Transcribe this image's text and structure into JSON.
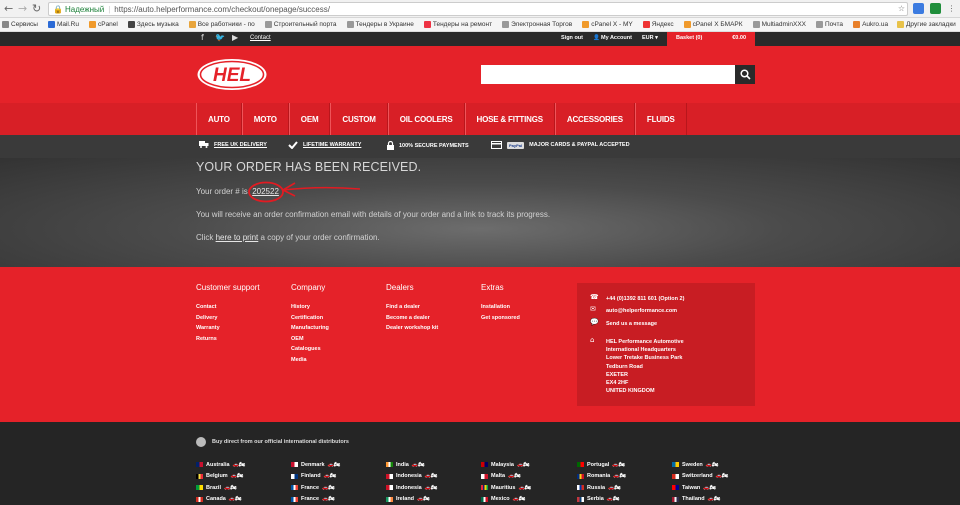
{
  "browser": {
    "secure_label": "Надежный",
    "url": "https://auto.helperformance.com/checkout/onepage/success/",
    "bookmarks": [
      "Сервисы",
      "Mail.Ru",
      "cPanel",
      "Здесь музыка",
      "Все работники - по",
      "Строительный порта",
      "Тендеры в Украине",
      "Тендеры на ремонт",
      "Электронная Торгов",
      "cPanel X - MY",
      "Яндекс",
      "cPanel X БМАРК",
      "MultiadminXXX",
      "Почта",
      "Aukro.ua",
      "Mail.Ru"
    ],
    "other_bookmarks": "Другие закладки"
  },
  "topbar": {
    "contact": "Contact",
    "sign_out": "Sign out",
    "my_account": "My Account",
    "currency": "EUR",
    "basket": "Basket (0)",
    "basket_total": "€0.00"
  },
  "logo_text": "HEL",
  "nav": [
    "AUTO",
    "MOTO",
    "OEM",
    "CUSTOM",
    "OIL COOLERS",
    "HOSE & FITTINGS",
    "ACCESSORIES",
    "FLUIDS"
  ],
  "usp": [
    "FREE UK DELIVERY",
    "LIFETIME WARRANTY",
    "100% SECURE PAYMENTS",
    "MAJOR CARDS & PAYPAL ACCEPTED"
  ],
  "usp_paypal": "PayPal",
  "order": {
    "title": "YOUR ORDER HAS BEEN RECEIVED.",
    "number_prefix": "Your order # is:",
    "number": "202522",
    "confirmation": "You will receive an order confirmation email with details of your order and a link to track its progress.",
    "print_pre": "Click",
    "print_link": "here to print",
    "print_post": "a copy of your order confirmation."
  },
  "footer": {
    "columns": [
      {
        "title": "Customer support",
        "links": [
          "Contact",
          "Delivery",
          "Warranty",
          "Returns"
        ]
      },
      {
        "title": "Company",
        "links": [
          "History",
          "Certification",
          "Manufacturing",
          "OEM",
          "Catalogues",
          "Media"
        ]
      },
      {
        "title": "Dealers",
        "links": [
          "Find a dealer",
          "Become a dealer",
          "Dealer workshop kit"
        ]
      },
      {
        "title": "Extras",
        "links": [
          "Installation",
          "Get sponsored"
        ]
      }
    ],
    "contact": {
      "phone": "+44 (0)1392 811 601 (Option 2)",
      "email": "auto@helperformance.com",
      "message": "Send us a message",
      "address": [
        "HEL Performance Automotive",
        "International Headquarters",
        "Lower Tretake Business Park",
        "Tedburn Road",
        "EXETER",
        "EX4 2HF",
        "UNITED KINGDOM"
      ]
    }
  },
  "distributors": {
    "heading": "Buy direct from our official international distributors",
    "columns": [
      [
        "Australia",
        "Belgium",
        "Brazil",
        "Canada",
        "Canada"
      ],
      [
        "Denmark",
        "Finland",
        "France",
        "France",
        "Germany"
      ],
      [
        "India",
        "Indonesia",
        "Indonesia",
        "Ireland",
        "Ireland"
      ],
      [
        "Malaysia",
        "Malta",
        "Mauritius",
        "Mexico",
        "Netherlands"
      ],
      [
        "Portugal",
        "Romania",
        "Russia",
        "Serbia",
        "Singapore"
      ],
      [
        "Sweden",
        "Switzerland",
        "Taiwan",
        "Thailand",
        "Thailand"
      ]
    ]
  },
  "colors": {
    "brand_red": "#e52229",
    "dark": "#2a2a2a",
    "annotation_red": "#e11b22"
  }
}
